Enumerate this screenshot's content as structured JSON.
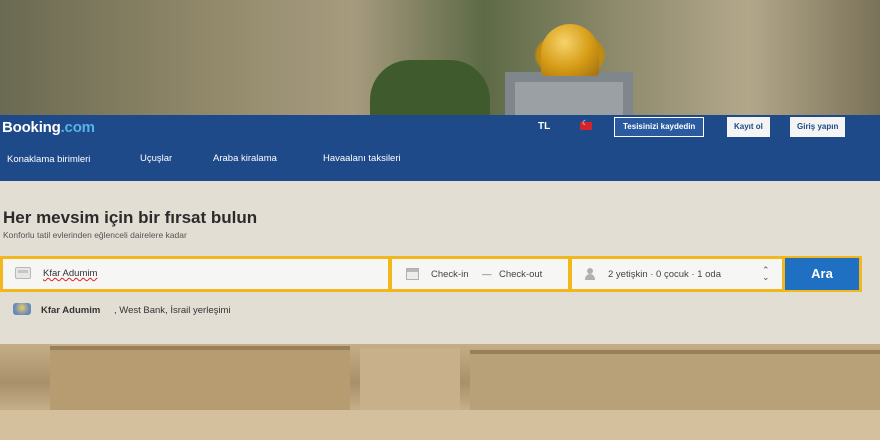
{
  "brand": {
    "name": "Booking",
    "tld": ".com"
  },
  "header": {
    "currency": "TL",
    "list_property": "Tesisinizi kaydedin",
    "signup": "Kayıt ol",
    "login": "Giriş yapın"
  },
  "nav": {
    "items": [
      "Konaklama birimleri",
      "Uçuşlar",
      "Araba kiralama",
      "Havaalanı taksileri"
    ]
  },
  "hero": {
    "title": "Her mevsim için bir fırsat bulun",
    "subtitle": "Konforlu tatil evlerinden eğlenceli dairelere kadar"
  },
  "search": {
    "destination_value": "Kfar Adumim",
    "checkin": "Check-in",
    "dash": "—",
    "checkout": "Check-out",
    "guests": "2 yetişkin · 0 çocuk · 1 oda",
    "button": "Ara"
  },
  "suggestion": {
    "name": "Kfar Adumim",
    "detail": ", West Bank, İsrail yerleşimi"
  },
  "colors": {
    "header_bg": "#1f4a8a",
    "search_border": "#f1b71c",
    "search_button": "#1f6fc2"
  }
}
